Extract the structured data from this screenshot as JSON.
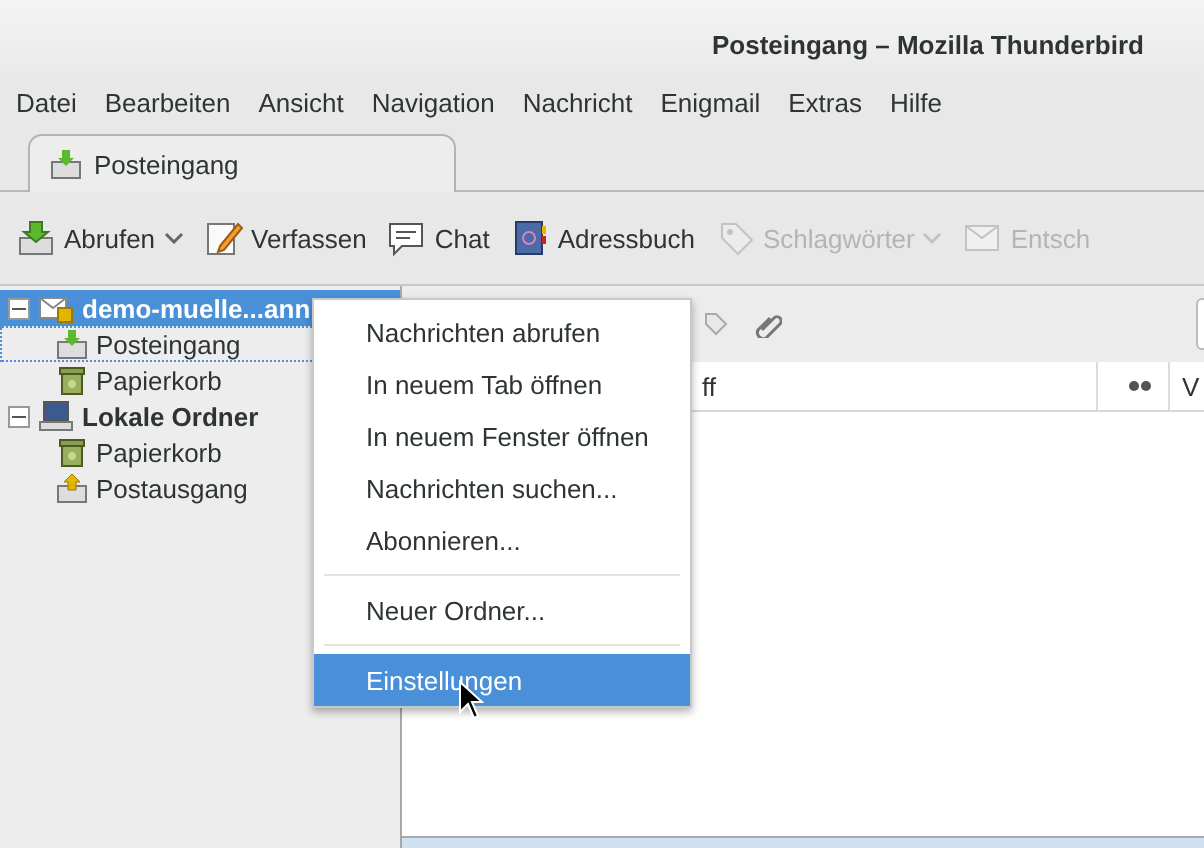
{
  "window": {
    "title": "Posteingang – Mozilla Thunderbird"
  },
  "menu_bar": [
    "Datei",
    "Bearbeiten",
    "Ansicht",
    "Navigation",
    "Nachricht",
    "Enigmail",
    "Extras",
    "Hilfe"
  ],
  "tabs": [
    {
      "label": "Posteingang",
      "selected": true
    }
  ],
  "toolbar": [
    {
      "kind": "download",
      "label": "Abrufen",
      "dropdown": true,
      "disabled": false
    },
    {
      "kind": "compose",
      "label": "Verfassen",
      "dropdown": false,
      "disabled": false
    },
    {
      "kind": "chat",
      "label": "Chat",
      "dropdown": false,
      "disabled": false
    },
    {
      "kind": "addressbook",
      "label": "Adressbuch",
      "dropdown": false,
      "disabled": false
    },
    {
      "kind": "tag",
      "label": "Schlagwörter",
      "dropdown": true,
      "disabled": true
    },
    {
      "kind": "junk",
      "label": "Entsch",
      "dropdown": false,
      "disabled": true
    }
  ],
  "folders": [
    {
      "kind": "account",
      "label": "demo-muelle...ann",
      "selected": true,
      "expanded": true,
      "children": [
        {
          "kind": "inbox",
          "label": "Posteingang",
          "selected": false,
          "focused": true
        },
        {
          "kind": "trash",
          "label": "Papierkorb",
          "selected": false,
          "focused": false
        }
      ]
    },
    {
      "kind": "local",
      "label": "Lokale Ordner",
      "selected": false,
      "expanded": true,
      "children": [
        {
          "kind": "trash",
          "label": "Papierkorb",
          "selected": false,
          "focused": false
        },
        {
          "kind": "outbox",
          "label": "Postausgang",
          "selected": false,
          "focused": false
        }
      ]
    }
  ],
  "message_list": {
    "columns": [
      {
        "kind": "text",
        "label": "ff"
      },
      {
        "kind": "icon"
      },
      {
        "kind": "text",
        "label": "V"
      }
    ]
  },
  "context_menu": [
    {
      "kind": "item",
      "label": "Nachrichten abrufen",
      "selected": false
    },
    {
      "kind": "item",
      "label": "In neuem Tab öffnen",
      "selected": false
    },
    {
      "kind": "item",
      "label": "In neuem Fenster öffnen",
      "selected": false
    },
    {
      "kind": "item",
      "label": "Nachrichten suchen...",
      "selected": false
    },
    {
      "kind": "item",
      "label": "Abonnieren...",
      "selected": false
    },
    {
      "kind": "separator"
    },
    {
      "kind": "item",
      "label": "Neuer Ordner...",
      "selected": false
    },
    {
      "kind": "separator"
    },
    {
      "kind": "item",
      "label": "Einstellungen",
      "selected": true
    }
  ]
}
